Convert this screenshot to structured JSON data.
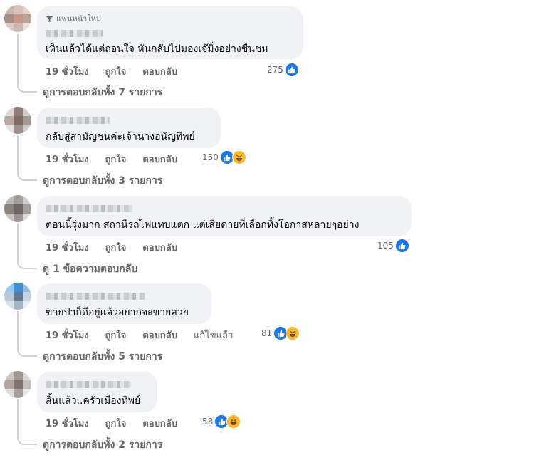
{
  "comments": [
    {
      "badge": "แฟนหน้าใหม่",
      "text": "เห็นแล้วได้แต่ถอนใจ หันกลับไปมองเจ๊มิ่งอย่างชื่นชม",
      "time": "19 ชั่วโมง",
      "like_label": "ถูกใจ",
      "reply_label": "ตอบกลับ",
      "reaction_count": "275",
      "reactions": [
        "like-icon"
      ],
      "replies": "ดูการตอบกลับทั้ง 7 รายการ"
    },
    {
      "text": "กลับสู่สามัญชนค่ะเจ้านางอนัญทิพย์",
      "time": "19 ชั่วโมง",
      "like_label": "ถูกใจ",
      "reply_label": "ตอบกลับ",
      "reaction_count": "150",
      "reactions": [
        "like-icon",
        "haha-icon"
      ],
      "replies": "ดูการตอบกลับทั้ง 3 รายการ"
    },
    {
      "text": "ตอนนี้รุ่งมาก สถานีรถไฟแทบแตก แต่เสียดายที่เลือกทิ้งโอกาสหลายๆอย่าง",
      "time": "19 ชั่วโมง",
      "like_label": "ถูกใจ",
      "reply_label": "ตอบกลับ",
      "reaction_count": "105",
      "reactions": [
        "like-icon"
      ],
      "replies": "ดู 1 ข้อความตอบกลับ"
    },
    {
      "text": "ขายป่าก็ดีอยู่แล้วอยากจะขายสวย",
      "time": "19 ชั่วโมง",
      "like_label": "ถูกใจ",
      "reply_label": "ตอบกลับ",
      "edited_label": "แก้ไขแล้ว",
      "reaction_count": "81",
      "reactions": [
        "like-icon",
        "haha-icon"
      ],
      "replies": "ดูการตอบกลับทั้ง 5 รายการ"
    },
    {
      "text": "สิ้นแล้ว..ครัวเมืองทิพย์",
      "time": "19 ชั่วโมง",
      "like_label": "ถูกใจ",
      "reply_label": "ตอบกลับ",
      "reaction_count": "58",
      "reactions": [
        "like-icon",
        "haha-icon"
      ],
      "replies": "ดูการตอบกลับทั้ง 2 รายการ"
    }
  ],
  "colors": {
    "bubble": "#f0f2f5",
    "meta": "#65676b",
    "like": "#1877f2",
    "haha": "#f7b928"
  }
}
